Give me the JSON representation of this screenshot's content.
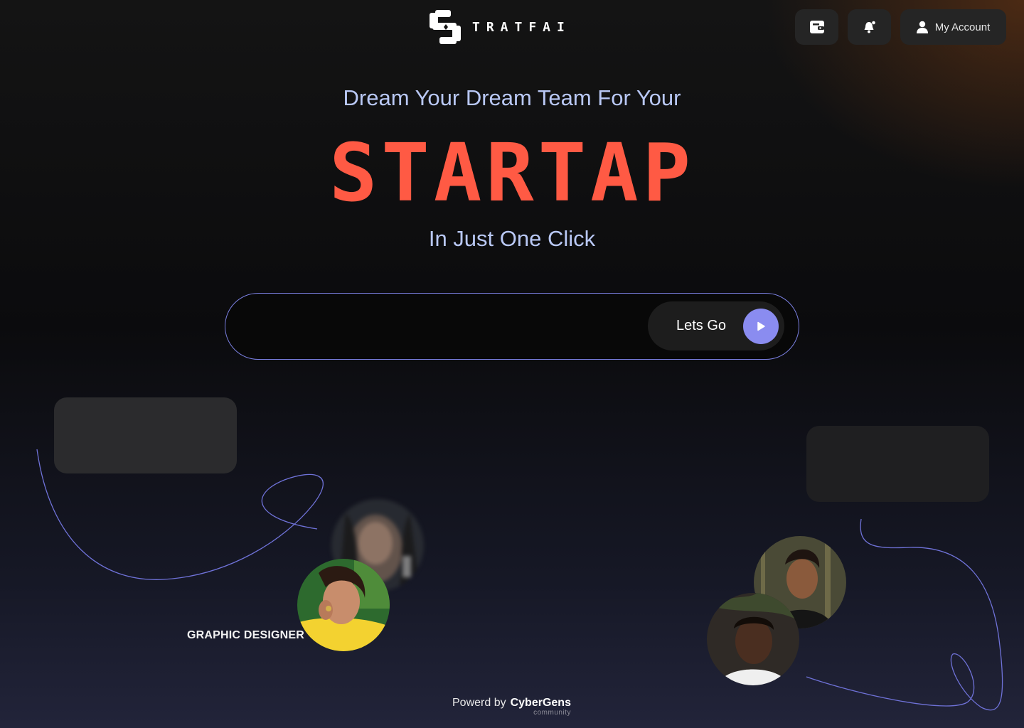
{
  "header": {
    "logo_text": "TRATFAI",
    "wallet_icon": "wallet-icon",
    "bell_icon": "bell-icon",
    "account_label": "My Account",
    "account_icon": "user-icon"
  },
  "hero": {
    "line1": "Dream Your Dream Team For Your",
    "big": "STARTAP",
    "line3": "In Just One Click"
  },
  "search": {
    "value": "",
    "placeholder": "",
    "button_label": "Lets Go",
    "button_icon": "play-icon"
  },
  "profiles": {
    "left_role": "GRAPHIC DESIGNER"
  },
  "footer": {
    "prefix": "Powerd by",
    "brand": "CyberGens",
    "sub": "community"
  },
  "colors": {
    "accent": "#ff5a44",
    "hero_text": "#b9c8f5",
    "button_accent": "#8a8cf0",
    "outline": "#7a7fe0"
  }
}
